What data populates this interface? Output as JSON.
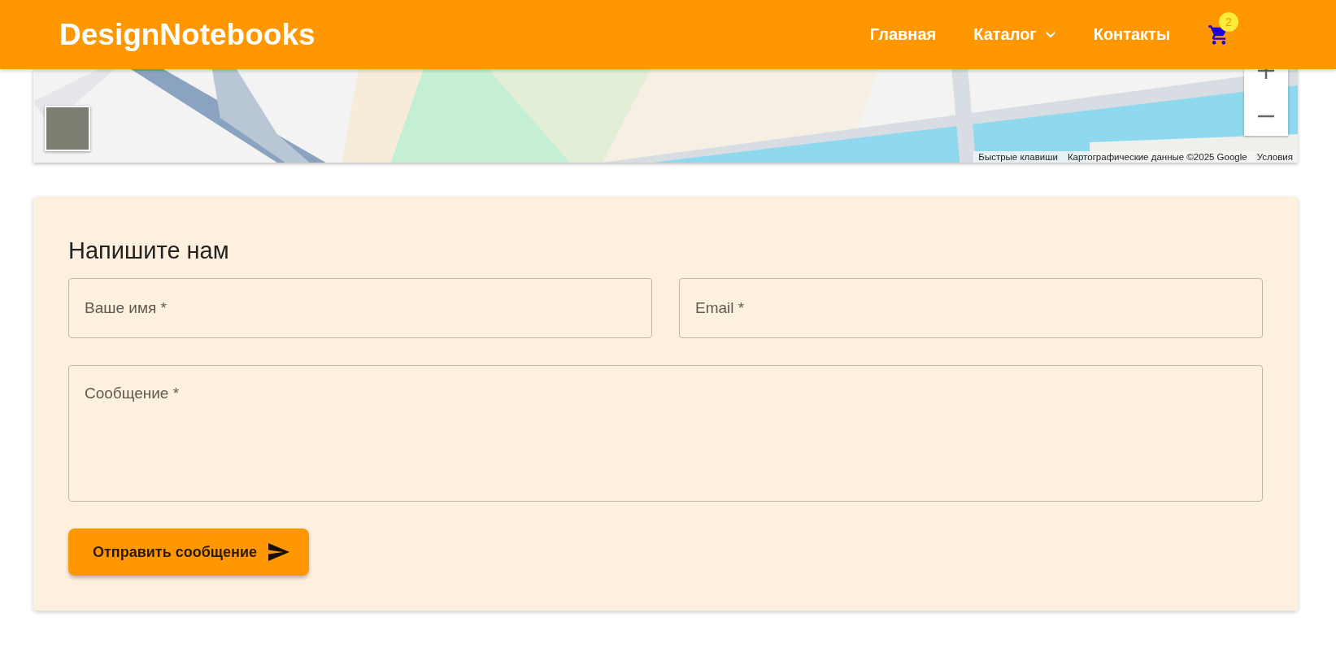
{
  "header": {
    "logo": "DesignNotebooks",
    "nav": [
      {
        "label": "Главная",
        "kind": "link"
      },
      {
        "label": "Каталог",
        "kind": "dropdown"
      },
      {
        "label": "Контакты",
        "kind": "link"
      }
    ],
    "cart": {
      "count": "2"
    }
  },
  "map": {
    "kind": "picture",
    "attribution": [
      "Быстрые клавиши",
      "Картографические данные ©2025 Google",
      "Условия"
    ]
  },
  "form": {
    "title": "Напишите нам",
    "fields": [
      {
        "placeholder": "Ваше имя *",
        "kind": "input"
      },
      {
        "placeholder": "Email *",
        "kind": "input"
      },
      {
        "placeholder": "Сообщение *",
        "kind": "textarea"
      }
    ],
    "submit": "Отправить сообщение"
  }
}
